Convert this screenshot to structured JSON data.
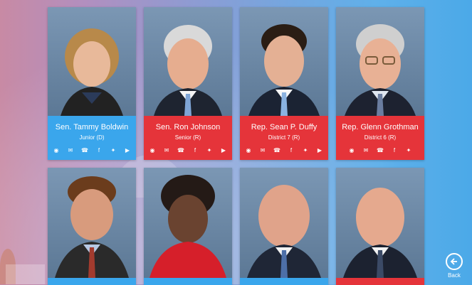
{
  "colors": {
    "senator_blue": "#3aa6ec",
    "rep_red": "#e5343a"
  },
  "cards": [
    {
      "name": "Sen. Tammy Boldwin",
      "subtitle": "Junior (D)"
    },
    {
      "name": "Sen. Ron Johnson",
      "subtitle": "Senior (R)"
    },
    {
      "name": "Rep. Sean P. Duffy",
      "subtitle": "District 7 (R)"
    },
    {
      "name": "Rep. Glenn Grothman",
      "subtitle": "District 6 (R)"
    }
  ],
  "contact_icons": [
    "globe-icon",
    "envelope-icon",
    "phone-icon",
    "facebook-icon",
    "twitter-icon",
    "youtube-icon"
  ],
  "back": {
    "label": "Back",
    "icon": "back-arrow-icon"
  }
}
